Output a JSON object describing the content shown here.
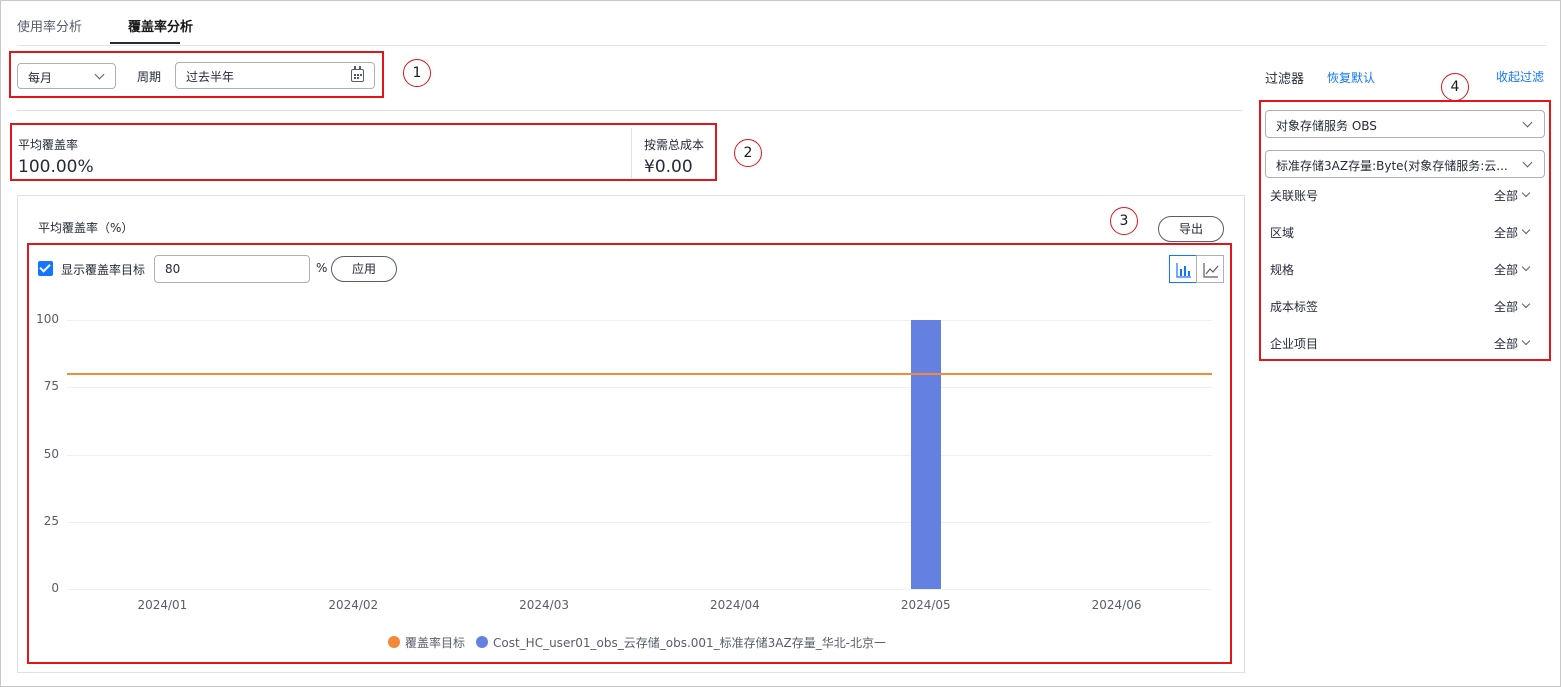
{
  "tabs": [
    {
      "label": "使用率分析"
    },
    {
      "label": "覆盖率分析"
    }
  ],
  "period": {
    "granularity": "每月",
    "label": "周期",
    "range": "过去半年"
  },
  "summary": {
    "avg_label": "平均覆盖率",
    "avg_value": "100.00%",
    "cost_label": "按需总成本",
    "cost_value": "¥0.00"
  },
  "chart_card": {
    "title": "平均覆盖率（%）",
    "export_label": "导出",
    "show_target_label": "显示覆盖率目标",
    "target_value": "80",
    "percent_sign": "%",
    "apply_label": "应用",
    "icons": {
      "bar": "bar-chart-icon",
      "line": "line-chart-icon"
    }
  },
  "callouts": [
    "1",
    "2",
    "3",
    "4"
  ],
  "chart_data": {
    "type": "bar",
    "categories": [
      "2024/01",
      "2024/02",
      "2024/03",
      "2024/04",
      "2024/05",
      "2024/06"
    ],
    "series": [
      {
        "name": "Cost_HC_user01_obs_云存储_obs.001_标准存储3AZ存量_华北-北京一",
        "values": [
          0,
          0,
          0,
          0,
          100,
          0
        ],
        "color": "#6480e0"
      }
    ],
    "target_line": {
      "name": "覆盖率目标",
      "value": 80,
      "color": "#f5893a"
    },
    "yticks": [
      0,
      25,
      50,
      75,
      100
    ],
    "ylim": [
      0,
      100
    ],
    "grid": true,
    "legend": "bottom-center"
  },
  "filter": {
    "title": "过滤器",
    "reset_label": "恢复默认",
    "collapse_label": "收起过滤",
    "service_select": "对象存储服务 OBS",
    "usage_select": "标准存储3AZ存量:Byte(对象存储服务:云...",
    "rows": [
      {
        "label": "关联账号",
        "value": "全部"
      },
      {
        "label": "区域",
        "value": "全部"
      },
      {
        "label": "规格",
        "value": "全部"
      },
      {
        "label": "成本标签",
        "value": "全部"
      },
      {
        "label": "企业项目",
        "value": "全部"
      }
    ]
  }
}
